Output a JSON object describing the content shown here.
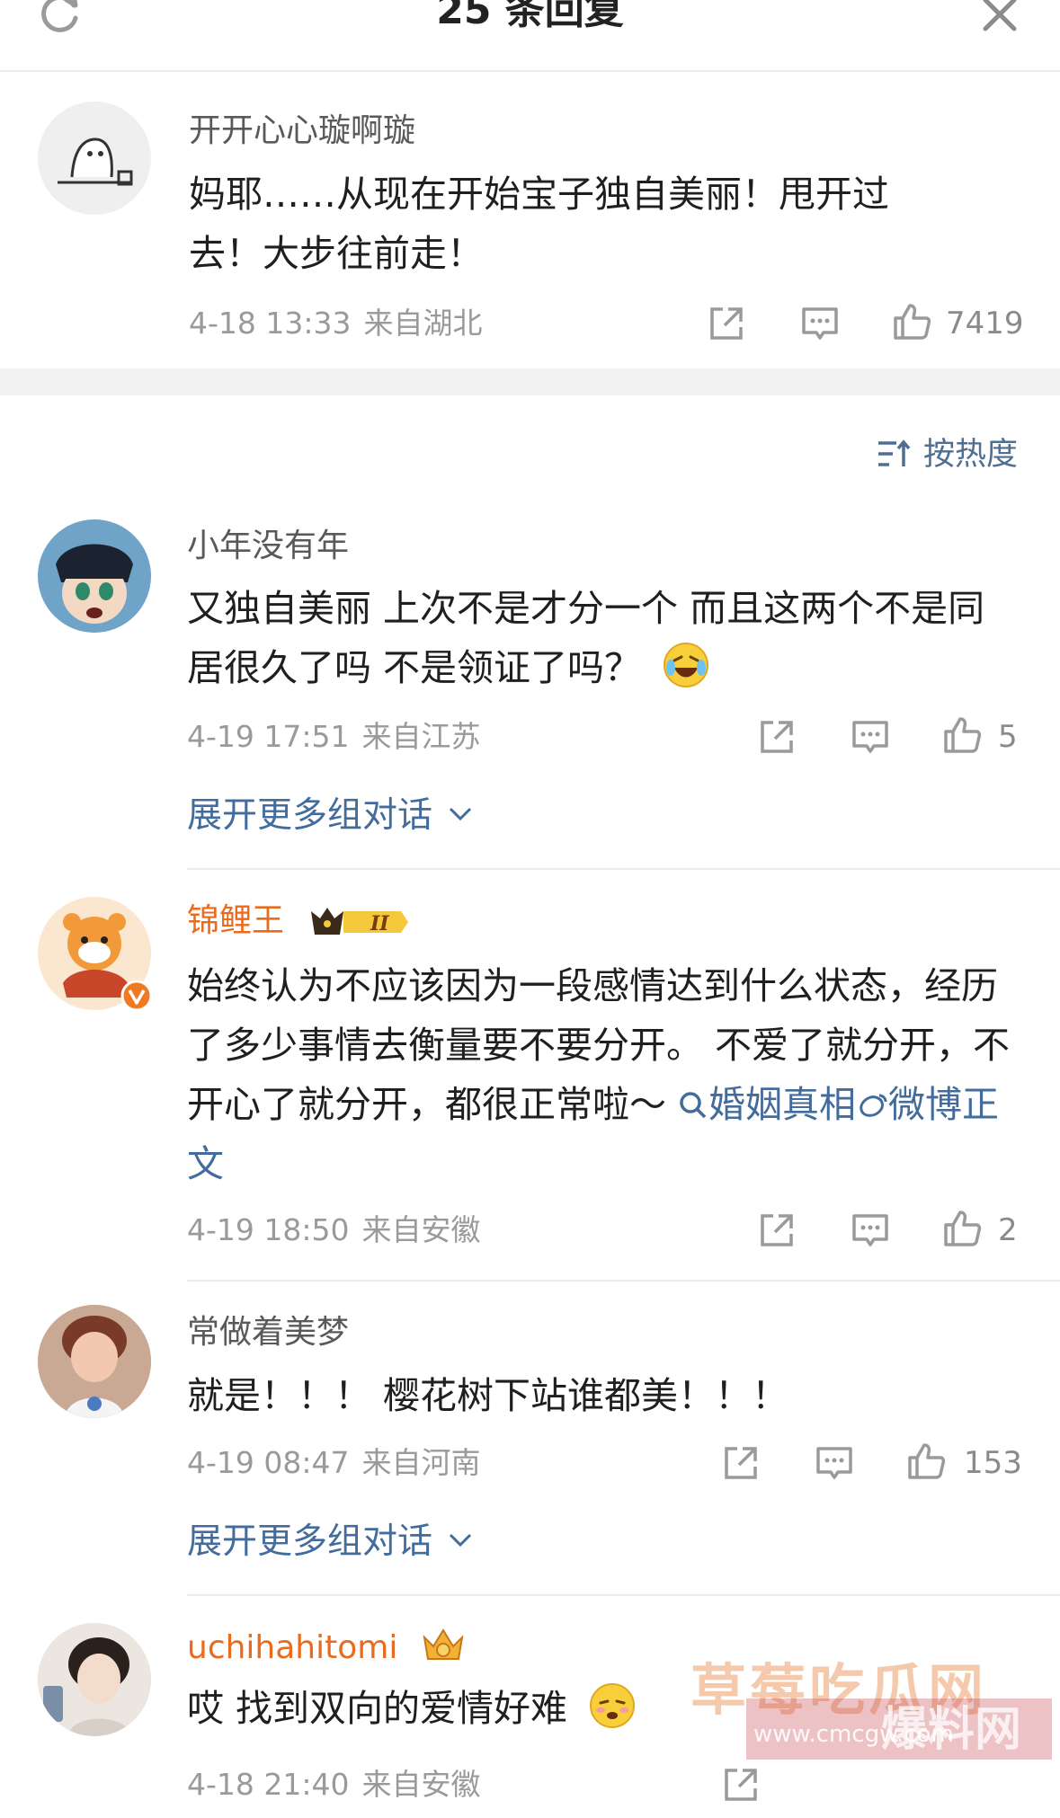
{
  "header": {
    "title": "25 条回复"
  },
  "top_comment": {
    "name": "开开心心璇啊璇",
    "text": "妈耶……从现在开始宝子独自美丽！甩开过去！大步往前走！",
    "time": "4-18 13:33",
    "location": "来自湖北",
    "likes": "7419"
  },
  "sort": {
    "label": "按热度"
  },
  "replies": [
    {
      "name": "小年没有年",
      "text": "又独自美丽 上次不是才分一个 而且这两个不是同居很久了吗 不是领证了吗？",
      "time": "4-19 17:51",
      "location": "来自江苏",
      "likes": "5",
      "expand": "展开更多组对话"
    },
    {
      "name": "锦鲤王",
      "badge": "II",
      "text": "始终认为不应该因为一段感情达到什么状态，经历了多少事情去衡量要不要分开。 不爱了就分开，不开心了就分开，都很正常啦～",
      "link1": "婚姻真相",
      "link2": "微博正文",
      "time": "4-19 18:50",
      "location": "来自安徽",
      "likes": "2"
    },
    {
      "name": "常做着美梦",
      "text": "就是！！！ 樱花树下站谁都美！！！",
      "time": "4-19 08:47",
      "location": "来自河南",
      "likes": "153",
      "expand": "展开更多组对话"
    },
    {
      "name": "uchihahitomi",
      "text": "哎 找到双向的爱情好难",
      "time": "4-18 21:40",
      "location": "来自安徽"
    }
  ],
  "watermark": {
    "cn": "草莓吃瓜网",
    "url": "www.cmcgw.com",
    "logo": "爆料网"
  },
  "colors": {
    "vip_name": "#e86b1f",
    "link": "#436c9c",
    "meta": "#9a9a9a"
  }
}
